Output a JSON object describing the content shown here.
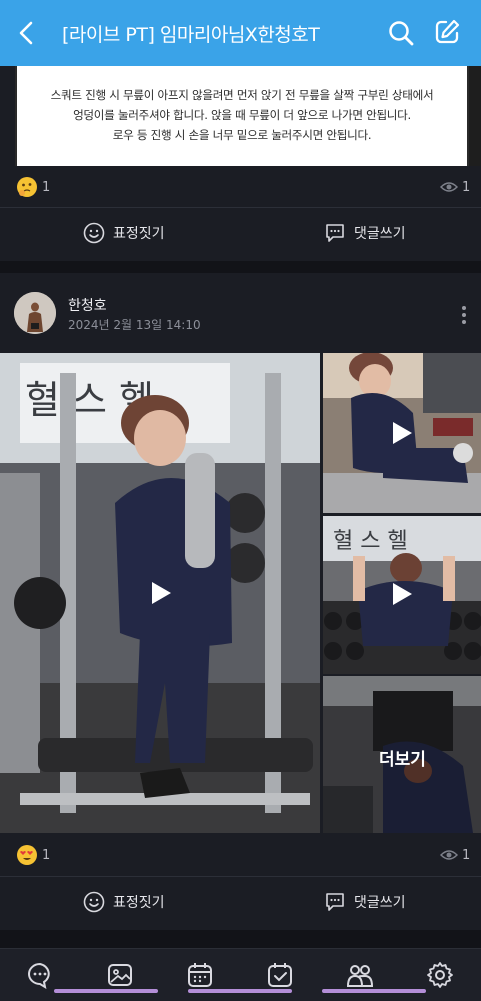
{
  "header": {
    "title": "[라이브 PT] 임마리아님X한청호T"
  },
  "notice": {
    "lines": [
      "스쿼트 진행 시 무릎이 아프지 않을려면 먼저 앉기 전 무릎을 살짝 구부린 상태에서",
      "엉덩이를 눌러주셔야 합니다. 앉을 때 무릎이 더 앞으로 나가면 안됩니다.",
      "로우 등 진행 시 손을 너무 밑으로 눌러주시면 안됩니다."
    ]
  },
  "post1": {
    "reaction_count": "1",
    "view_count": "1",
    "emotion_label": "표정짓기",
    "comment_label": "댓글쓰기"
  },
  "post2": {
    "author": "한청호",
    "date": "2024년 2월 13일 14:10",
    "more_label": "더보기",
    "reaction_count": "1",
    "view_count": "1",
    "emotion_label": "표정짓기",
    "comment_label": "댓글쓰기"
  },
  "colors": {
    "header": "#3aa3e8",
    "background": "#1b1d24",
    "nav_indicator": "#b48ed8"
  },
  "bottom_nav": [
    "chat-icon",
    "photo-icon",
    "calendar-icon",
    "checklist-icon",
    "members-icon",
    "settings-icon"
  ]
}
